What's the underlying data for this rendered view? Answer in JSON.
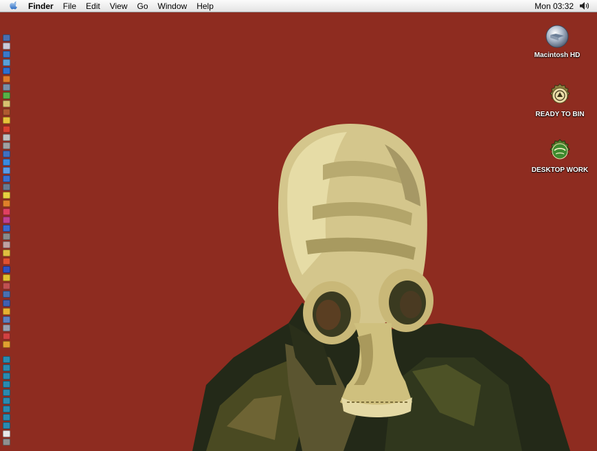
{
  "menubar": {
    "apple_icon": "apple-icon",
    "app_name": "Finder",
    "menus": [
      "File",
      "Edit",
      "View",
      "Go",
      "Window",
      "Help"
    ],
    "clock": "Mon 03:32",
    "volume_icon": "speaker-icon"
  },
  "desktop": {
    "icons": [
      {
        "label": "Macintosh HD",
        "icon": "hard-drive-icon"
      },
      {
        "label": "READY TO BIN",
        "icon": "bottle-cap-icon"
      },
      {
        "label": "DESKTOP WORK",
        "icon": "carlsberg-cap-icon"
      }
    ],
    "wallpaper": "gas-mask-portrait"
  },
  "dock": {
    "colors": [
      "#4a6fb0",
      "#c9c9d8",
      "#3b78c8",
      "#5aa0d8",
      "#2e6fd0",
      "#e07a2a",
      "#7c8fa8",
      "#58b046",
      "#d8c070",
      "#b05a30",
      "#e8c23a",
      "#d84030",
      "#bfbfbf",
      "#a0a0a0",
      "#4070c0",
      "#3a8ae0",
      "#5a9ae8",
      "#3a70d0",
      "#6a7a90",
      "#e8d040",
      "#e0802a",
      "#e04060",
      "#c04090",
      "#3a6ad0",
      "#8a8a8a",
      "#c0a0a0",
      "#e0c040",
      "#e05030",
      "#3050c0",
      "#e0c030",
      "#c05050",
      "#4a70b0",
      "#4060b0",
      "#e8b030",
      "#6080c0",
      "#9aa0b0",
      "#d04040",
      "#e0a030",
      "#2a8ab0",
      "#2a8ab0",
      "#2a8ab0",
      "#2a8ab0",
      "#2a8ab0",
      "#2a8ab0",
      "#2a8ab0",
      "#2a8ab0",
      "#2a8ab0",
      "#e8e8e8",
      "#909090"
    ]
  }
}
